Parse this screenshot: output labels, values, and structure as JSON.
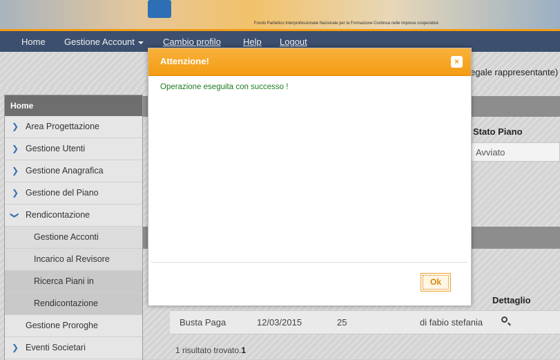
{
  "header": {
    "tagline": "Fondo Paritetico Interprofessionale Nazionale per la Formazione Continua nelle imprese cooperative"
  },
  "navbar": {
    "items": [
      "Home",
      "Gestione Account",
      "Cambio profilo",
      "Help",
      "Logout"
    ]
  },
  "user": {
    "role_text": "egale rappresentante)"
  },
  "sidebar": {
    "title": "Home",
    "items": [
      "Area Progettazione",
      "Gestione Utenti",
      "Gestione Anagrafica",
      "Gestione del Piano",
      "Rendicontazione",
      "Gestione Acconti",
      "Incarico al Revisore",
      "Ricerca Piani in",
      "Rendicontazione",
      "Gestione Proroghe",
      "Eventi Societari"
    ]
  },
  "filters": {
    "stato_label": "Stato Piano",
    "stato_value": "Avviato"
  },
  "table": {
    "dettaglio_header": "Dettaglio",
    "row": [
      "Busta Paga",
      "12/03/2015",
      "25",
      "di fabio stefania"
    ]
  },
  "results": {
    "text": "1 risultato trovato.",
    "count": "1"
  },
  "modal": {
    "title": "Attenzione!",
    "close": "×",
    "message": "Operazione eseguita con successo !",
    "ok_label": "Ok"
  },
  "colors": {
    "accent": "#f39c12",
    "nav_bg": "#3c4f6e",
    "success": "#1e7a1e"
  }
}
